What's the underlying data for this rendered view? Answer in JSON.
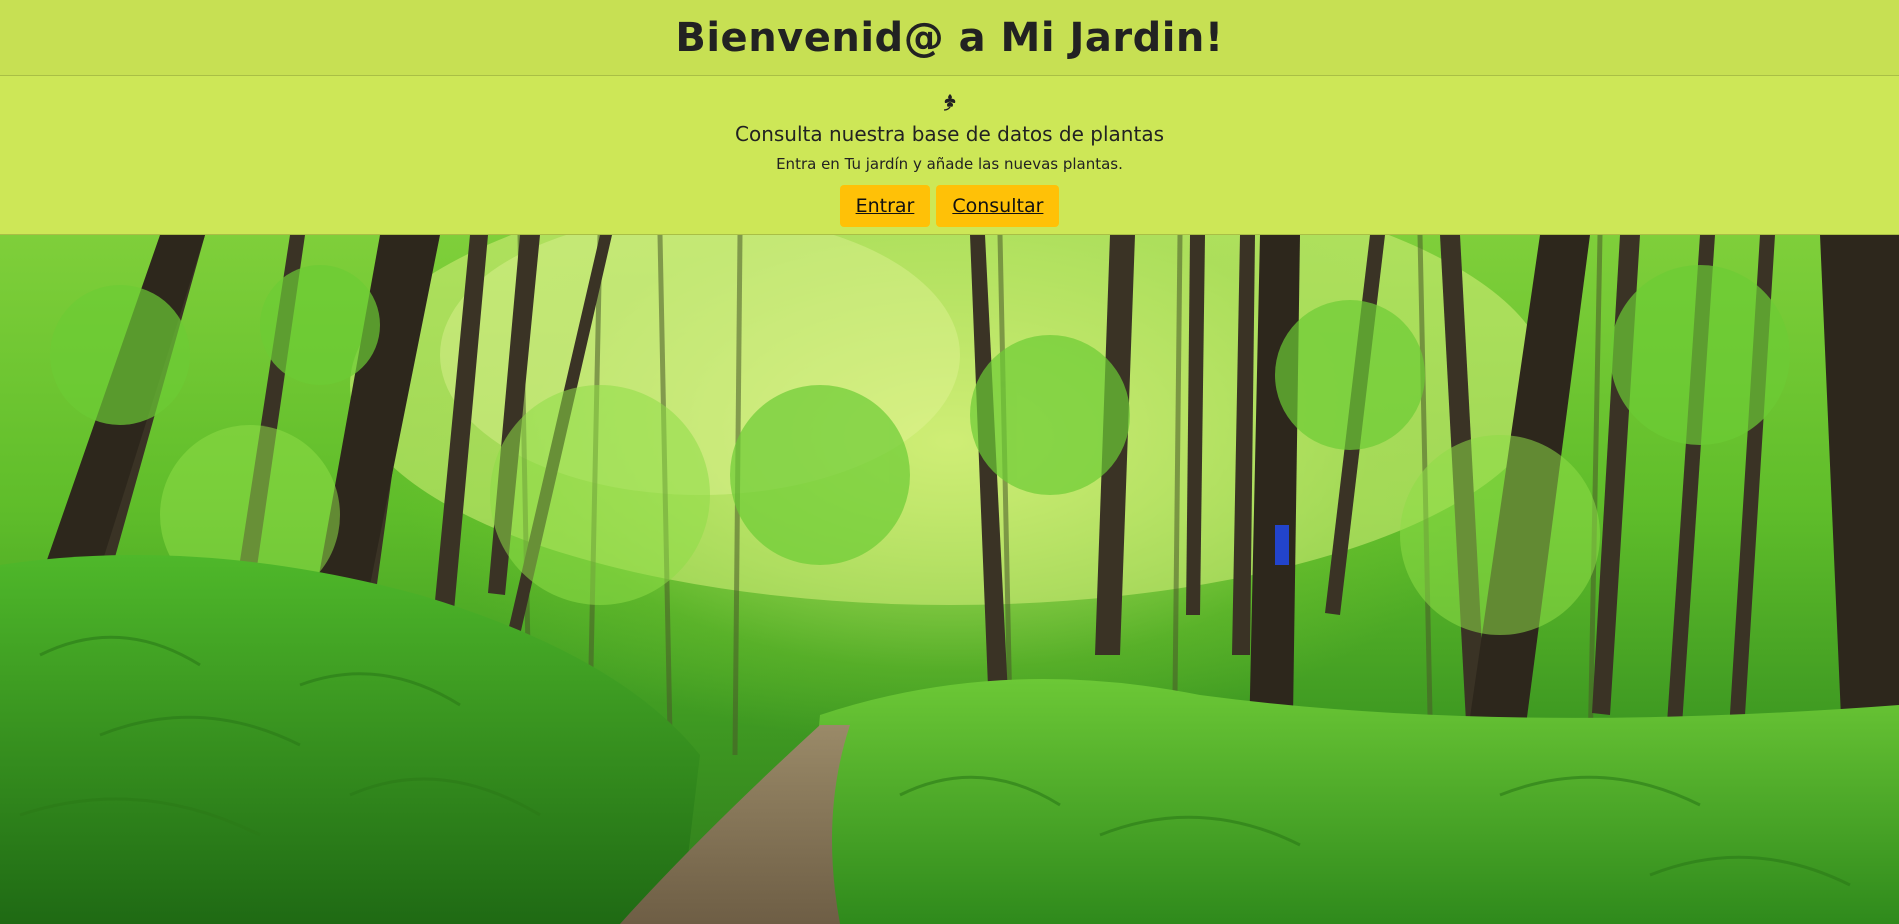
{
  "header": {
    "title": "Bienvenid@ a Mi Jardin!"
  },
  "intro": {
    "icon": "leaf-icon",
    "subtitle": "Consulta nuestra base de datos de plantas",
    "description": "Entra en Tu jardín y añade las nuevas plantas.",
    "buttons": {
      "enter_label": "Entrar",
      "consult_label": "Consultar"
    }
  },
  "colors": {
    "header_bg": "#c7e053",
    "intro_bg": "#cde757",
    "button_bg": "#ffc107"
  }
}
